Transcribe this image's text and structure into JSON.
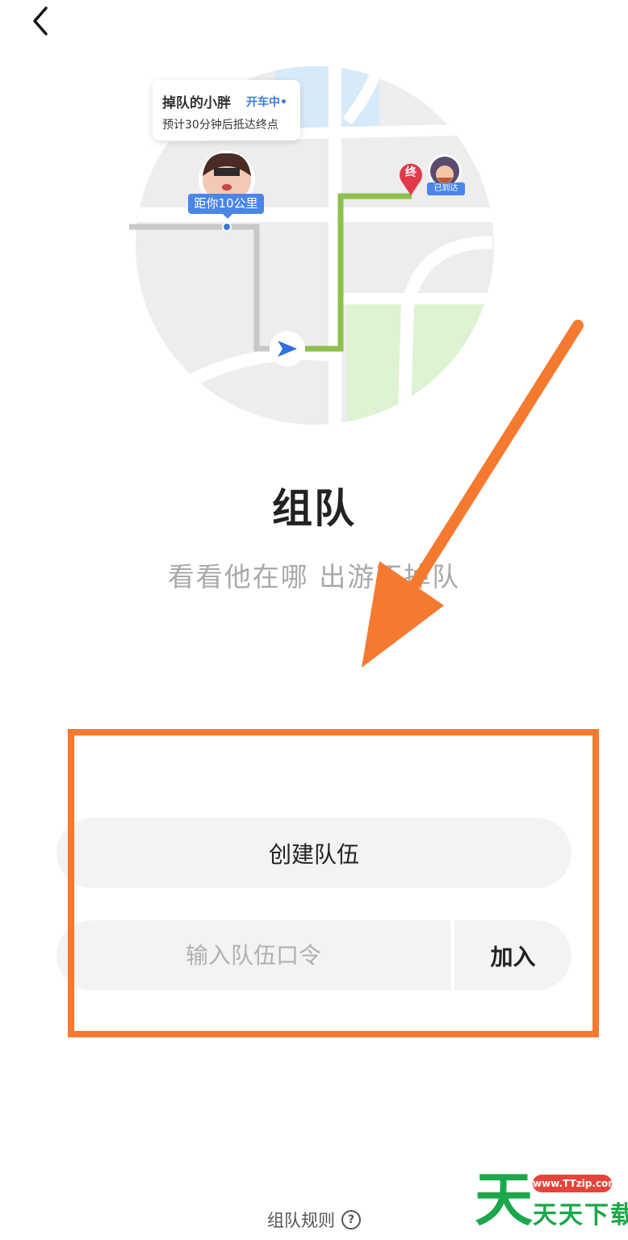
{
  "nav": {
    "back_icon": "chevron-left-icon"
  },
  "illustration": {
    "driver_name": "掉队的小胖",
    "driver_status": "开车中•",
    "driver_eta": "预计30分钟后抵达终点",
    "distance_label": "距你10公里",
    "end_marker": "终",
    "arrived_label": "已到达",
    "colors": {
      "route_done": "#8cc04a",
      "route_pending": "#c8c8c8",
      "marker_blue": "#4a86e8",
      "end_red": "#e23a4a"
    }
  },
  "title": "组队",
  "subtitle": "看看他在哪 出游不掉队",
  "actions": {
    "create_label": "创建队伍",
    "code_placeholder": "输入队伍口令",
    "code_value": "",
    "join_label": "加入"
  },
  "footer": {
    "rules_label": "组队规则",
    "help_icon": "question-circle-icon"
  },
  "annotation": {
    "color": "#f5792f"
  },
  "watermark": {
    "logo_char": "天",
    "url": "www.TTzip.com",
    "name": "天天下载"
  }
}
